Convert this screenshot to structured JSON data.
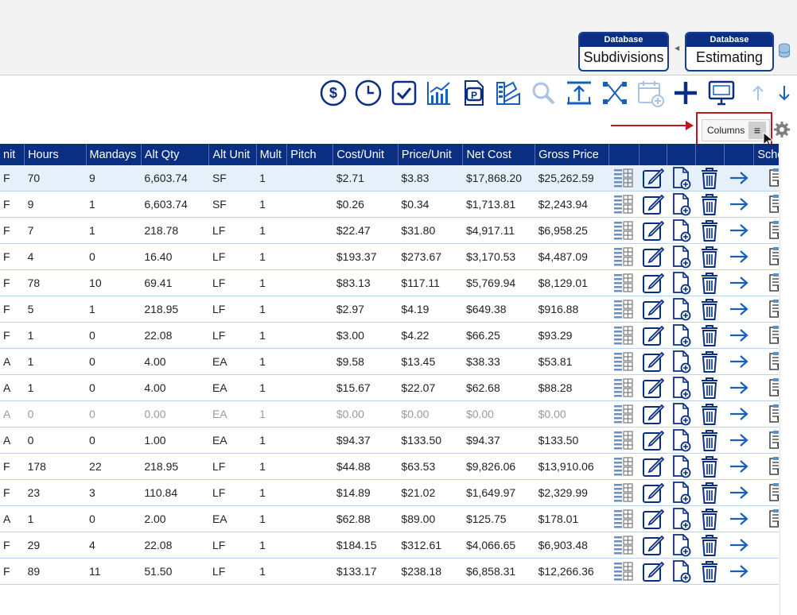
{
  "databases": [
    {
      "header": "Database",
      "name": "Subdivisions"
    },
    {
      "header": "Database",
      "name": "Estimating"
    }
  ],
  "toolbar": {
    "icons": [
      "dollar-icon",
      "clock-icon",
      "checkbox-icon",
      "chart-icon",
      "pdf-icon",
      "palette-icon",
      "search-icon",
      "upload-icon",
      "network-icon",
      "calendar-add-icon",
      "plus-icon",
      "monitor-icon",
      "arrow-up-icon",
      "arrow-down-icon"
    ]
  },
  "columns_button": {
    "label": "Columns",
    "menu_glyph": "≡"
  },
  "grid": {
    "headers": [
      "nit",
      "Hours",
      "Mandays",
      "Alt Qty",
      "Alt Unit",
      "Mult",
      "Pitch",
      "Cost/Unit",
      "Price/Unit",
      "Net Cost",
      "Gross Price",
      "",
      "",
      "",
      "",
      "",
      "Schedu"
    ],
    "rows": [
      {
        "unit": "F",
        "hours": "70",
        "mandays": "9",
        "alt_qty": "6,603.74",
        "alt_unit": "SF",
        "mult": "1",
        "pitch": "",
        "cost_unit": "$2.71",
        "price_unit": "$3.83",
        "net_cost": "$17,868.20",
        "gross_price": "$25,262.59",
        "state": "selected",
        "schedule": true
      },
      {
        "unit": "F",
        "hours": "9",
        "mandays": "1",
        "alt_qty": "6,603.74",
        "alt_unit": "SF",
        "mult": "1",
        "pitch": "",
        "cost_unit": "$0.26",
        "price_unit": "$0.34",
        "net_cost": "$1,713.81",
        "gross_price": "$2,243.94",
        "state": "",
        "schedule": true
      },
      {
        "unit": "F",
        "hours": "7",
        "mandays": "1",
        "alt_qty": "218.78",
        "alt_unit": "LF",
        "mult": "1",
        "pitch": "",
        "cost_unit": "$22.47",
        "price_unit": "$31.80",
        "net_cost": "$4,917.11",
        "gross_price": "$6,958.25",
        "state": "",
        "schedule": true
      },
      {
        "unit": "F",
        "hours": "4",
        "mandays": "0",
        "alt_qty": "16.40",
        "alt_unit": "LF",
        "mult": "1",
        "pitch": "",
        "cost_unit": "$193.37",
        "price_unit": "$273.67",
        "net_cost": "$3,170.53",
        "gross_price": "$4,487.09",
        "state": "",
        "schedule": true
      },
      {
        "unit": "F",
        "hours": "78",
        "mandays": "10",
        "alt_qty": "69.41",
        "alt_unit": "LF",
        "mult": "1",
        "pitch": "",
        "cost_unit": "$83.13",
        "price_unit": "$117.11",
        "net_cost": "$5,769.94",
        "gross_price": "$8,129.01",
        "state": "",
        "schedule": true
      },
      {
        "unit": "F",
        "hours": "5",
        "mandays": "1",
        "alt_qty": "218.95",
        "alt_unit": "LF",
        "mult": "1",
        "pitch": "",
        "cost_unit": "$2.97",
        "price_unit": "$4.19",
        "net_cost": "$649.38",
        "gross_price": "$916.88",
        "state": "",
        "schedule": true
      },
      {
        "unit": "F",
        "hours": "1",
        "mandays": "0",
        "alt_qty": "22.08",
        "alt_unit": "LF",
        "mult": "1",
        "pitch": "",
        "cost_unit": "$3.00",
        "price_unit": "$4.22",
        "net_cost": "$66.25",
        "gross_price": "$93.29",
        "state": "",
        "schedule": true
      },
      {
        "unit": "A",
        "hours": "1",
        "mandays": "0",
        "alt_qty": "4.00",
        "alt_unit": "EA",
        "mult": "1",
        "pitch": "",
        "cost_unit": "$9.58",
        "price_unit": "$13.45",
        "net_cost": "$38.33",
        "gross_price": "$53.81",
        "state": "",
        "schedule": true
      },
      {
        "unit": "A",
        "hours": "1",
        "mandays": "0",
        "alt_qty": "4.00",
        "alt_unit": "EA",
        "mult": "1",
        "pitch": "",
        "cost_unit": "$15.67",
        "price_unit": "$22.07",
        "net_cost": "$62.68",
        "gross_price": "$88.28",
        "state": "",
        "schedule": true
      },
      {
        "unit": "A",
        "hours": "0",
        "mandays": "0",
        "alt_qty": "0.00",
        "alt_unit": "EA",
        "mult": "1",
        "pitch": "",
        "cost_unit": "$0.00",
        "price_unit": "$0.00",
        "net_cost": "$0.00",
        "gross_price": "$0.00",
        "state": "dim",
        "schedule": true
      },
      {
        "unit": "A",
        "hours": "0",
        "mandays": "0",
        "alt_qty": "1.00",
        "alt_unit": "EA",
        "mult": "1",
        "pitch": "",
        "cost_unit": "$94.37",
        "price_unit": "$133.50",
        "net_cost": "$94.37",
        "gross_price": "$133.50",
        "state": "",
        "schedule": true
      },
      {
        "unit": "F",
        "hours": "178",
        "mandays": "22",
        "alt_qty": "218.95",
        "alt_unit": "LF",
        "mult": "1",
        "pitch": "",
        "cost_unit": "$44.88",
        "price_unit": "$63.53",
        "net_cost": "$9,826.06",
        "gross_price": "$13,910.06",
        "state": "",
        "schedule": true
      },
      {
        "unit": "F",
        "hours": "23",
        "mandays": "3",
        "alt_qty": "110.84",
        "alt_unit": "LF",
        "mult": "1",
        "pitch": "",
        "cost_unit": "$14.89",
        "price_unit": "$21.02",
        "net_cost": "$1,649.97",
        "gross_price": "$2,329.99",
        "state": "",
        "schedule": true
      },
      {
        "unit": "A",
        "hours": "1",
        "mandays": "0",
        "alt_qty": "2.00",
        "alt_unit": "EA",
        "mult": "1",
        "pitch": "",
        "cost_unit": "$62.88",
        "price_unit": "$89.00",
        "net_cost": "$125.75",
        "gross_price": "$178.01",
        "state": "",
        "schedule": true
      },
      {
        "unit": "F",
        "hours": "29",
        "mandays": "4",
        "alt_qty": "22.08",
        "alt_unit": "LF",
        "mult": "1",
        "pitch": "",
        "cost_unit": "$184.15",
        "price_unit": "$312.61",
        "net_cost": "$4,066.65",
        "gross_price": "$6,903.48",
        "state": "",
        "schedule": false
      },
      {
        "unit": "F",
        "hours": "89",
        "mandays": "11",
        "alt_qty": "51.50",
        "alt_unit": "LF",
        "mult": "1",
        "pitch": "",
        "cost_unit": "$133.17",
        "price_unit": "$238.18",
        "net_cost": "$6,858.31",
        "gross_price": "$12,266.36",
        "state": "",
        "schedule": false
      }
    ]
  },
  "colors": {
    "header": "#0a2e82",
    "accent": "#1560bd",
    "highlight": "#c0161c",
    "selected_row": "#e6f0fb"
  }
}
